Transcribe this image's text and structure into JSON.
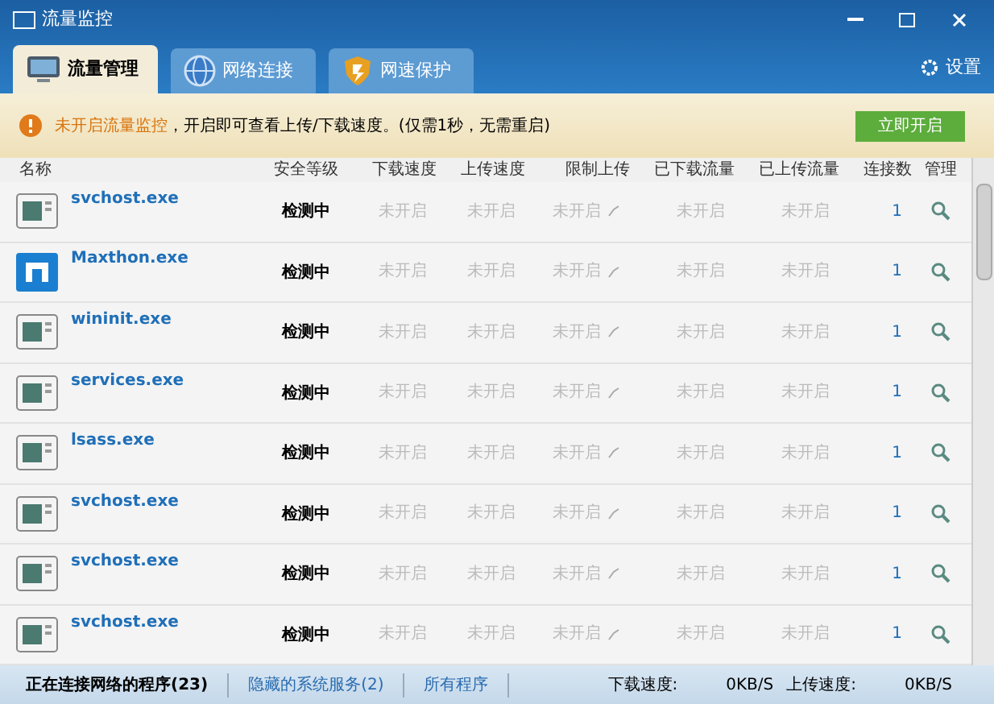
{
  "window": {
    "title": "流量监控"
  },
  "tabs": [
    {
      "label": "流量管理",
      "selected": true
    },
    {
      "label": "网络连接",
      "selected": false
    },
    {
      "label": "网速保护",
      "selected": false
    }
  ],
  "settings": {
    "label": "设置"
  },
  "banner": {
    "warning": "未开启流量监控",
    "message": "，开启即可查看上传/下载速度。(仅需1秒，无需重启)",
    "button": "立即开启"
  },
  "table": {
    "columns": [
      "名称",
      "安全等级",
      "下载速度",
      "上传速度",
      "限制上传",
      "已下载流量",
      "已上传流量",
      "连接数",
      "管理"
    ],
    "rows": [
      {
        "kind": "program",
        "cells": [
          "svchost.exe",
          "检测中",
          "未开启",
          "未开启",
          "未开启",
          "未开启",
          "未开启",
          "1"
        ]
      },
      {
        "kind": "app",
        "cells": [
          "Maxthon.exe",
          "检测中",
          "未开启",
          "未开启",
          "未开启",
          "未开启",
          "未开启",
          "1"
        ]
      },
      {
        "kind": "program",
        "cells": [
          "wininit.exe",
          "检测中",
          "未开启",
          "未开启",
          "未开启",
          "未开启",
          "未开启",
          "1"
        ]
      },
      {
        "kind": "program",
        "cells": [
          "services.exe",
          "检测中",
          "未开启",
          "未开启",
          "未开启",
          "未开启",
          "未开启",
          "1"
        ]
      },
      {
        "kind": "program",
        "cells": [
          "lsass.exe",
          "检测中",
          "未开启",
          "未开启",
          "未开启",
          "未开启",
          "未开启",
          "1"
        ]
      },
      {
        "kind": "program",
        "cells": [
          "svchost.exe",
          "检测中",
          "未开启",
          "未开启",
          "未开启",
          "未开启",
          "未开启",
          "1"
        ]
      },
      {
        "kind": "program",
        "cells": [
          "svchost.exe",
          "检测中",
          "未开启",
          "未开启",
          "未开启",
          "未开启",
          "未开启",
          "1"
        ]
      },
      {
        "kind": "program",
        "cells": [
          "svchost.exe",
          "检测中",
          "未开启",
          "未开启",
          "未开启",
          "未开启",
          "未开启",
          "1"
        ]
      }
    ]
  },
  "footer": {
    "tabs": [
      {
        "label": "正在连接网络的程序(23)",
        "selected": true
      },
      {
        "label": "隐藏的系统服务(2)",
        "selected": false
      },
      {
        "label": "所有程序",
        "selected": false
      }
    ],
    "download_label": "下载速度:",
    "download_value": "0KB/S",
    "upload_label": "上传速度:",
    "upload_value": "0KB/S"
  }
}
